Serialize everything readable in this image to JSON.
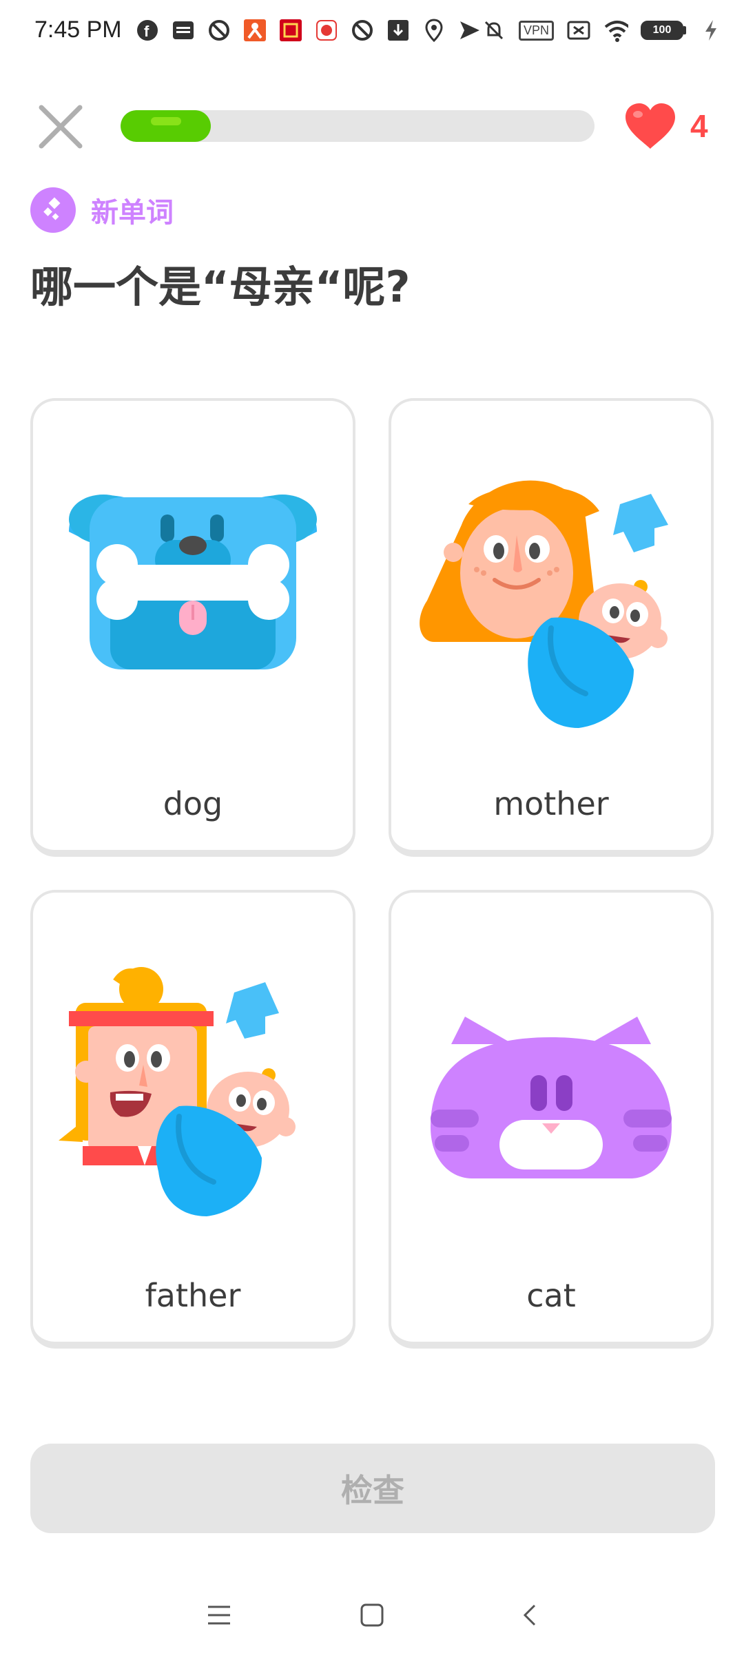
{
  "status_bar": {
    "time": "7:45 PM",
    "icons_left": [
      "facebook-icon",
      "webtoon-icon",
      "block-icon",
      "app-icon",
      "app-icon",
      "app-icon",
      "block-icon",
      "download-icon",
      "location-icon",
      "send-icon"
    ],
    "icons_right": [
      "mute-icon",
      "vpn-icon",
      "sim-icon",
      "wifi-icon",
      "battery-icon",
      "charging-icon"
    ],
    "vpn_label": "VPN",
    "battery_level": "100"
  },
  "lesson": {
    "progress": 0.19,
    "hearts": "4",
    "tag": "新单词",
    "question": "哪一个是“母亲“呢?"
  },
  "options": [
    {
      "label": "dog",
      "image": "dog-illustration"
    },
    {
      "label": "mother",
      "image": "mother-illustration"
    },
    {
      "label": "father",
      "image": "father-illustration"
    },
    {
      "label": "cat",
      "image": "cat-illustration"
    }
  ],
  "check_button": {
    "label": "检查"
  },
  "colors": {
    "accent_green": "#58cc02",
    "heart_red": "#ff4b4b",
    "tag_purple": "#ce82ff",
    "card_border": "#e5e5e5"
  }
}
